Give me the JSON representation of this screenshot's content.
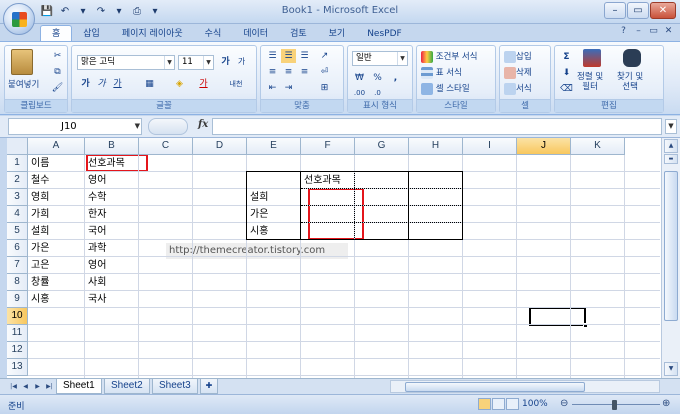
{
  "window": {
    "title": "Book1 - Microsoft Excel"
  },
  "qat": [
    "💾",
    "↶",
    "▾",
    "↷",
    "▾",
    "⎙",
    "▾"
  ],
  "tabs": [
    "홈",
    "삽입",
    "페이지 레이아웃",
    "수식",
    "데이터",
    "검토",
    "보기",
    "NesPDF"
  ],
  "ribbon": {
    "clipboard": {
      "label": "클립보드",
      "paste": "붙여넣기"
    },
    "font": {
      "label": "글꼴",
      "name": "맑은 고딕",
      "size": "11",
      "grow": "가",
      "shrink": "가",
      "bold": "가",
      "italic": "가",
      "underline": "가",
      "color_btn": "가",
      "phonetic": "내천"
    },
    "align": {
      "label": "맞춤"
    },
    "number": {
      "label": "표시 형식",
      "format": "일반",
      "currency": "₩",
      "percent": "%",
      "comma": ","
    },
    "style": {
      "label": "스타일",
      "cond": "조건부 서식",
      "table": "표 서식",
      "cell": "셀 스타일"
    },
    "cells": {
      "label": "셀",
      "insert": "삽입",
      "delete": "삭제",
      "format": "서식"
    },
    "edit": {
      "label": "편집",
      "sum": "Σ",
      "sort": "정렬 및\n필터",
      "find": "찾기 및\n선택"
    }
  },
  "formula": {
    "name_box": "J10",
    "fx": "fx",
    "value": ""
  },
  "columns": [
    "A",
    "B",
    "C",
    "D",
    "E",
    "F",
    "G",
    "H",
    "I",
    "J",
    "K"
  ],
  "selected_column": "J",
  "selected_row": "10",
  "rows": [
    "1",
    "2",
    "3",
    "4",
    "5",
    "6",
    "7",
    "8",
    "9",
    "10",
    "11",
    "12",
    "13"
  ],
  "cells": {
    "A1": "이름",
    "B1": "선호과목",
    "A2": "철수",
    "B2": "영어",
    "A3": "영희",
    "B3": "수학",
    "A4": "가희",
    "B4": "한자",
    "A5": "설희",
    "B5": "국어",
    "A6": "가은",
    "B6": "과학",
    "A7": "고은",
    "B7": "영어",
    "A8": "창률",
    "B8": "사회",
    "A9": "시홍",
    "B9": "국사",
    "F2": "선호과목",
    "E3": "설희",
    "E4": "가은",
    "E5": "시홍"
  },
  "watermark": "http://themecreator.tistory.com",
  "sheets": [
    "Sheet1",
    "Sheet2",
    "Sheet3"
  ],
  "active_sheet": "Sheet1",
  "status": {
    "mode": "준비",
    "zoom": "100%"
  },
  "colors": {
    "highlight_border": "#e4151b",
    "selection_header": "#f8c75e"
  }
}
